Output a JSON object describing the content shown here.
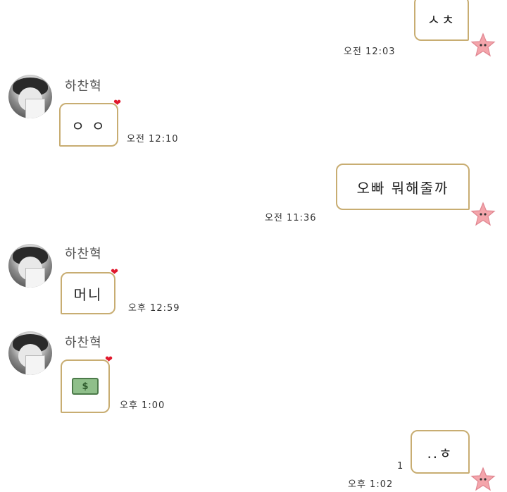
{
  "messages": [
    {
      "dir": "sent",
      "text": "ㅅㅊ",
      "time": "오전 12:03"
    },
    {
      "dir": "recv",
      "name": "하찬혁",
      "text": "ㅇ ㅇ",
      "time": "오전 12:10"
    },
    {
      "dir": "sent",
      "text": "오빠 뭐해줄까",
      "time": "오전 11:36"
    },
    {
      "dir": "recv",
      "name": "하찬혁",
      "text": "머니",
      "time": "오후 12:59"
    },
    {
      "dir": "recv",
      "name": "하찬혁",
      "emoji": "money-bill-emoji",
      "text": "$",
      "time": "오후 1:00"
    },
    {
      "dir": "sent",
      "text": "..ㅎ",
      "time": "오후 1:02",
      "unread": "1"
    }
  ],
  "colors": {
    "bubble_border": "#c8ad72",
    "heart": "#e0182c",
    "star": "#f4a5ab"
  }
}
